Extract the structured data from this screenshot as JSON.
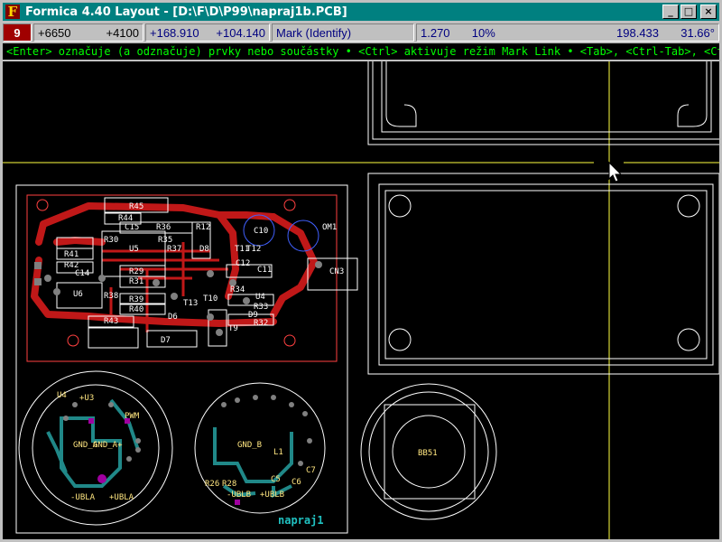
{
  "window": {
    "app_letter": "F",
    "title": "Formica 4.40 Layout - [D:\\F\\D\\P99\\napraj1b.PCB]",
    "buttons": {
      "minimize": "_",
      "maximize": "□",
      "close": "×"
    }
  },
  "status": {
    "layer": "9",
    "grid_x": "+6650",
    "grid_y": "+4100",
    "coord_x": "+168.910",
    "coord_y": "+104.140",
    "mode": "Mark (Identify)",
    "grid_size": "1.270",
    "zoom": "10%",
    "length": "198.433",
    "angle": "31.66°"
  },
  "hint": "<Enter> označuje (a odznačuje) prvky nebo součástky  •  <Ctrl> aktivuje režim Mark Link  •  <Tab>, <Ctrl-Tab>, <Ctrl-",
  "board": {
    "components": [
      "R45",
      "R44",
      "C15",
      "R36",
      "R12",
      "U5",
      "R37",
      "D8",
      "C10",
      "R41",
      "R42",
      "C14",
      "R30",
      "R35",
      "R29",
      "R31",
      "C12",
      "C11",
      "OM1",
      "CN3",
      "U6",
      "R38",
      "R39",
      "R40",
      "T13",
      "R34",
      "U4",
      "R33",
      "D9",
      "R32",
      "R43",
      "D6",
      "D7",
      "T10",
      "T9",
      "T11",
      "T12",
      "BB51"
    ],
    "project_label": "napraj1",
    "round_labels": [
      "U4",
      "+U3",
      "PWM",
      "GND_A",
      "GND_A+",
      "-UBLA",
      "+UBLA",
      "GND_B",
      "L1",
      "-UBLB",
      "+UBLB",
      "R26",
      "R28",
      "C5",
      "C6",
      "C7"
    ]
  },
  "colors": {
    "titlebar": "#008080",
    "layer_badge": "#a00000",
    "hint_text": "#00ff00",
    "copper_top": "#c01818",
    "copper_bottom": "#208888",
    "crosshair": "#ffff40"
  }
}
